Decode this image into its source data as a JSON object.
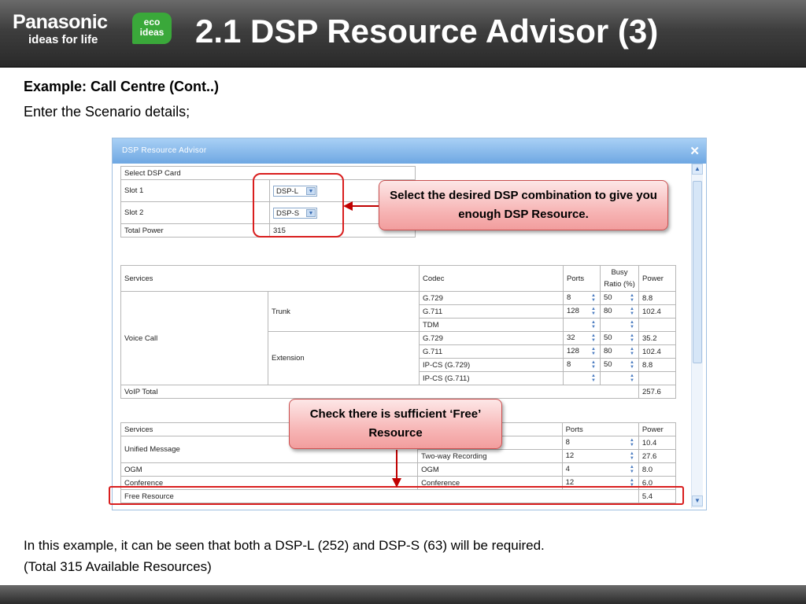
{
  "header": {
    "brand": "Panasonic",
    "tagline": "ideas for life",
    "eco_line1": "eco",
    "eco_line2": "ideas",
    "title": "2.1 DSP Resource Advisor (3)"
  },
  "subheading": "Example: Call Centre (Cont..)",
  "intro": "Enter the Scenario details;",
  "dialog": {
    "title": "DSP Resource Advisor",
    "close_icon": "close-icon",
    "card": {
      "header": "Select DSP Card",
      "slot1_label": "Slot 1",
      "slot1_value": "DSP-L",
      "slot2_label": "Slot 2",
      "slot2_value": "DSP-S",
      "total_label": "Total Power",
      "total_value": "315"
    },
    "voip": {
      "col_services": "Services",
      "col_codec": "Codec",
      "col_ports": "Ports",
      "col_busy1": "Busy",
      "col_busy2": "Ratio (%)",
      "col_power": "Power",
      "group": "Voice Call",
      "trunk": "Trunk",
      "extension": "Extension",
      "rows": [
        {
          "codec": "G.729",
          "ports": "8",
          "busy": "50",
          "power": "8.8"
        },
        {
          "codec": "G.711",
          "ports": "128",
          "busy": "80",
          "power": "102.4"
        },
        {
          "codec": "TDM",
          "ports": "",
          "busy": "",
          "power": ""
        },
        {
          "codec": "G.729",
          "ports": "32",
          "busy": "50",
          "power": "35.2"
        },
        {
          "codec": "G.711",
          "ports": "128",
          "busy": "80",
          "power": "102.4"
        },
        {
          "codec": "IP-CS (G.729)",
          "ports": "8",
          "busy": "50",
          "power": "8.8"
        },
        {
          "codec": "IP-CS (G.711)",
          "ports": "",
          "busy": "",
          "power": ""
        }
      ],
      "total_label": "VoIP Total",
      "total_value": "257.6"
    },
    "other": {
      "col_services": "Services",
      "col_ports": "Ports",
      "col_power": "Power",
      "rows": [
        {
          "service": "Unified Message",
          "type": "",
          "ports": "8",
          "power": "10.4"
        },
        {
          "service": "",
          "type": "Two-way Recording",
          "ports": "12",
          "power": "27.6"
        },
        {
          "service": "OGM",
          "type": "OGM",
          "ports": "4",
          "power": "8.0"
        },
        {
          "service": "Conference",
          "type": "Conference",
          "ports": "12",
          "power": "6.0"
        }
      ],
      "free_label": "Free Resource",
      "free_value": "5.4"
    }
  },
  "callouts": {
    "dsp": "Select the desired DSP combination to give you enough DSP Resource.",
    "free": "Check there is sufficient ‘Free’ Resource"
  },
  "conclusion_line1": "In this example, it can be seen that both a DSP-L (252) and DSP-S  (63) will be required.",
  "conclusion_line2": "(Total 315 Available Resources)",
  "colors": {
    "accent": "#d91e1e",
    "dialog_title": "#6ea7e2",
    "header": "#3e3e3e"
  }
}
